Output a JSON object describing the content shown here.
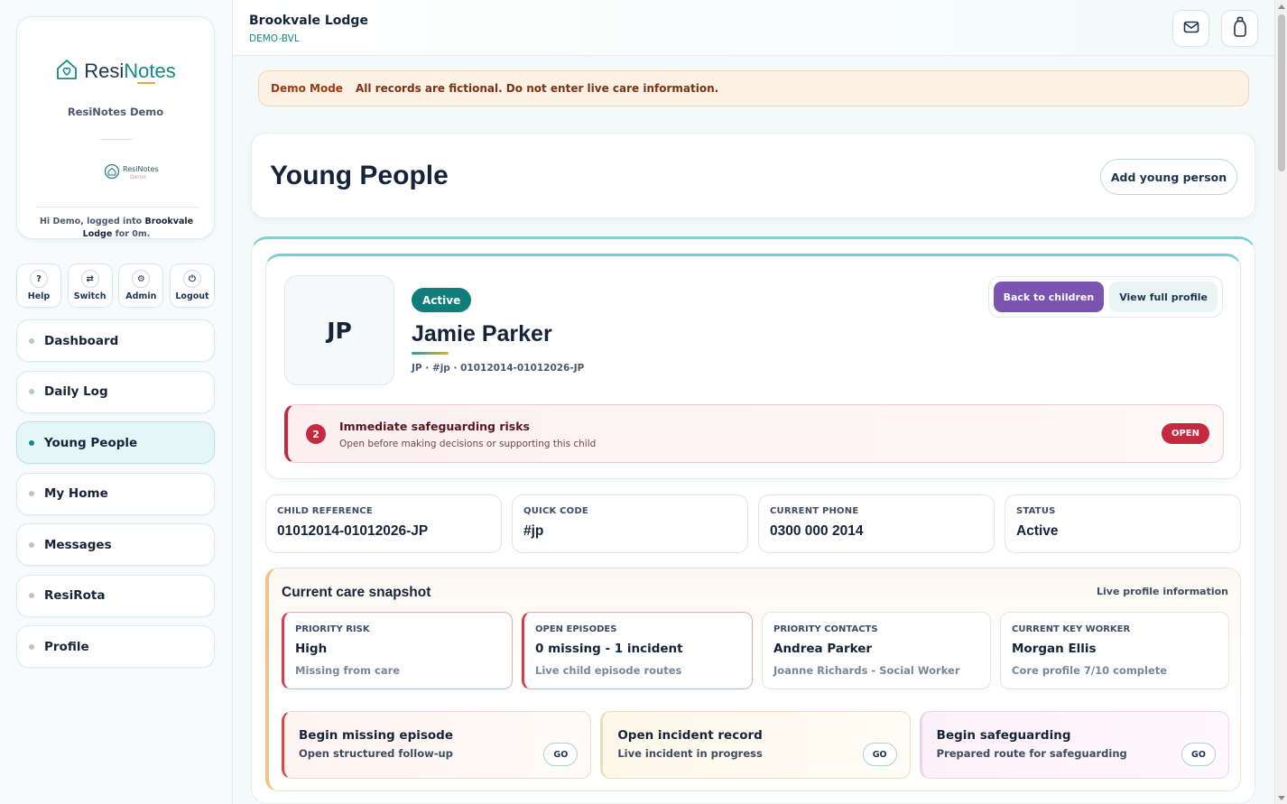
{
  "brand": {
    "name_part1": "Resi",
    "name_part2": "Notes",
    "subtitle": "ResiNotes Demo",
    "mini_logo_text": "ResiNotes",
    "mini_logo_demo": "Demo",
    "greeting_prefix": "Hi Demo, logged into ",
    "greeting_home": "Brookvale Lodge",
    "greeting_suffix": " for 0m."
  },
  "quick_actions": [
    {
      "label": "Help",
      "icon": "?"
    },
    {
      "label": "Switch",
      "icon": "⇄"
    },
    {
      "label": "Admin",
      "icon": "⚙"
    },
    {
      "label": "Logout",
      "icon": "⏻"
    }
  ],
  "nav": [
    {
      "label": "Dashboard"
    },
    {
      "label": "Daily Log"
    },
    {
      "label": "Young People",
      "active": true
    },
    {
      "label": "My Home"
    },
    {
      "label": "Messages"
    },
    {
      "label": "ResiRota"
    },
    {
      "label": "Profile"
    }
  ],
  "header": {
    "title": "Brookvale Lodge",
    "code": "DEMO-BVL"
  },
  "demo_banner": {
    "tag": "Demo Mode",
    "message": "All records are fictional. Do not enter live care information."
  },
  "page": {
    "title": "Young People",
    "add_button": "Add young person"
  },
  "person": {
    "initials": "JP",
    "status": "Active",
    "name": "Jamie Parker",
    "meta": "JP · #jp · 01012014-01012026-JP",
    "back_button": "Back to children",
    "profile_button": "View full profile"
  },
  "risk": {
    "count": "2",
    "title": "Immediate safeguarding risks",
    "subtitle": "Open before making decisions or supporting this child",
    "action": "OPEN"
  },
  "stats": [
    {
      "label": "CHILD REFERENCE",
      "value": "01012014-01012026-JP"
    },
    {
      "label": "QUICK CODE",
      "value": "#jp"
    },
    {
      "label": "CURRENT PHONE",
      "value": "0300 000 2014"
    },
    {
      "label": "STATUS",
      "value": "Active"
    }
  ],
  "snapshot": {
    "title": "Current care snapshot",
    "note": "Live profile information",
    "cards": [
      {
        "label": "PRIORITY RISK",
        "value": "High",
        "sub": "Missing from care",
        "alert": true
      },
      {
        "label": "OPEN EPISODES",
        "value": "0 missing - 1 incident",
        "sub": "Live child episode routes",
        "alert": true
      },
      {
        "label": "PRIORITY CONTACTS",
        "value": "Andrea Parker",
        "sub": "Joanne Richards - Social Worker",
        "alert": false
      },
      {
        "label": "CURRENT KEY WORKER",
        "value": "Morgan Ellis",
        "sub": "Core profile 7/10 complete",
        "alert": false
      }
    ],
    "actions": [
      {
        "title": "Begin missing episode",
        "desc": "Open structured follow-up",
        "go": "GO"
      },
      {
        "title": "Open incident record",
        "desc": "Live incident in progress",
        "go": "GO"
      },
      {
        "title": "Begin safeguarding",
        "desc": "Prepared route for safeguarding",
        "go": "GO"
      }
    ]
  },
  "icons": {
    "mail": "mail-icon",
    "bottle": "bottle-icon",
    "house_heart": "house-heart-icon"
  },
  "colors": {
    "accent_teal": "#138a86",
    "primary_purple": "#7b53b0",
    "danger_red": "#c6283f",
    "banner_bg": "#fdf1e6"
  }
}
